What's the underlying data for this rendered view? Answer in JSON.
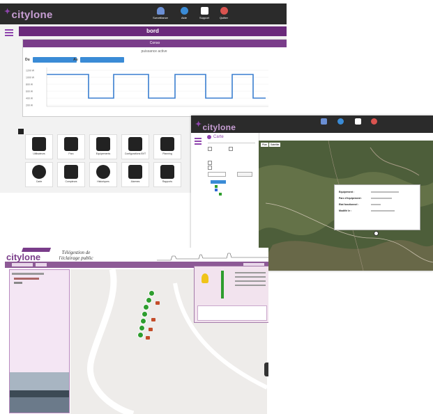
{
  "screen1": {
    "logo": "citylone",
    "nav": [
      {
        "label": "Surveillance",
        "icon": "bell-icon",
        "color": "#6b8fd4"
      },
      {
        "label": "Aide",
        "icon": "help-globe-icon",
        "color": "#3a8bd6"
      },
      {
        "label": "Support",
        "icon": "document-icon",
        "color": "#ffffff"
      },
      {
        "label": "Quitter",
        "icon": "power-icon",
        "color": "#d9534f"
      }
    ],
    "page_title": "bord",
    "chart_panel_title": "Conso",
    "chart_title": "puissance active",
    "date_from_label": "Du",
    "date_to_label": "Au",
    "y_ticks": [
      "1200 W",
      "1000 W",
      "800 W",
      "600 W",
      "400 W",
      "200 W"
    ],
    "x_ticks": [
      "",
      "",
      ""
    ],
    "tiles": [
      {
        "label": "Utilisateurs",
        "icon": "user-add-icon"
      },
      {
        "label": "Parc",
        "icon": "building-icon"
      },
      {
        "label": "Equipements",
        "icon": "tools-icon"
      },
      {
        "label": "Configurations BVT",
        "icon": "config-gear-icon"
      },
      {
        "label": "Planning",
        "icon": "calendar-icon"
      },
      {
        "label": "Carte",
        "icon": "globe-icon"
      },
      {
        "label": "Compteurs",
        "icon": "meter-icon"
      },
      {
        "label": "Historiques",
        "icon": "clock-icon"
      },
      {
        "label": "Alarmes",
        "icon": "alarm-bell-icon"
      },
      {
        "label": "Rapports",
        "icon": "report-icon"
      }
    ]
  },
  "screen2": {
    "logo": "citylone",
    "section_title": "Carte",
    "map_tabs": [
      "Plan",
      "Satellite"
    ],
    "tree_root": "",
    "popup_rows": [
      {
        "label": "Equipement :",
        "value": ""
      },
      {
        "label": "Parc d'équipement :",
        "value": ""
      },
      {
        "label": "Etat fonctionnel :",
        "value": ""
      },
      {
        "label": "Modifié le :",
        "value": ""
      }
    ]
  },
  "screen3": {
    "logo": "citylone",
    "subtitle_line1": "Télégestion de",
    "subtitle_line2": "l'éclairage public"
  }
}
